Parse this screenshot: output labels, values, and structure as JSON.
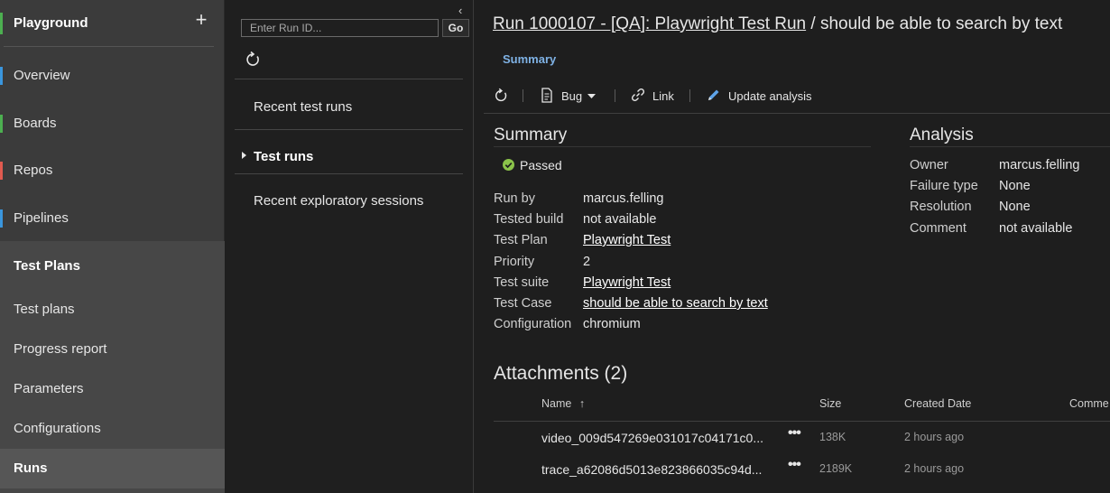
{
  "nav": {
    "project": "Playground",
    "add_label": "+",
    "items": [
      {
        "label": "Overview",
        "color": "#3a96dd"
      },
      {
        "label": "Boards",
        "color": "#4caf50"
      },
      {
        "label": "Repos",
        "color": "#e05a4f"
      },
      {
        "label": "Pipelines",
        "color": "#3a96dd"
      },
      {
        "label": "Test Plans",
        "color": "#8e44ad"
      }
    ],
    "sub_items": [
      {
        "label": "Test plans"
      },
      {
        "label": "Progress report"
      },
      {
        "label": "Parameters"
      },
      {
        "label": "Configurations"
      },
      {
        "label": "Runs"
      }
    ]
  },
  "mid": {
    "collapse_label": "‹",
    "run_id_placeholder": "Enter Run ID...",
    "go_label": "Go",
    "items": [
      {
        "label": "Recent test runs"
      },
      {
        "label": "Test runs"
      },
      {
        "label": "Recent exploratory sessions"
      }
    ]
  },
  "main": {
    "title_link": "Run 1000107 - [QA]: Playwright Test Run",
    "title_rest": " / should be able to search by text",
    "tab": "Summary",
    "toolbar": {
      "bug_label": "Bug",
      "link_label": "Link",
      "update_label": "Update analysis"
    },
    "summary": {
      "title": "Summary",
      "outcome": "Passed",
      "fields": [
        {
          "key": "Run by",
          "value": "marcus.felling",
          "link": false
        },
        {
          "key": "Tested build",
          "value": "not available",
          "link": false
        },
        {
          "key": "Test Plan",
          "value": "Playwright Test",
          "link": true
        },
        {
          "key": "Priority",
          "value": "2",
          "link": false
        },
        {
          "key": "Test suite",
          "value": "Playwright Test",
          "link": true
        },
        {
          "key": "Test Case",
          "value": "should be able to search by text",
          "link": true
        },
        {
          "key": "Configuration",
          "value": "chromium",
          "link": false
        }
      ]
    },
    "analysis": {
      "title": "Analysis",
      "fields": [
        {
          "key": "Owner",
          "value": "marcus.felling"
        },
        {
          "key": "Failure type",
          "value": "None"
        },
        {
          "key": "Resolution",
          "value": "None"
        },
        {
          "key": "Comment",
          "value": "not available"
        }
      ]
    },
    "attachments": {
      "title": "Attachments (2)",
      "columns": {
        "name": "Name",
        "sort": "↑",
        "size": "Size",
        "created": "Created Date",
        "comment": "Comme"
      },
      "rows": [
        {
          "name": "video_009d547269e031017c04171c0...",
          "size": "138K",
          "created": "2 hours ago"
        },
        {
          "name": "trace_a62086d5013e823866035c94d...",
          "size": "2189K",
          "created": "2 hours ago"
        }
      ],
      "more_label": "•••"
    }
  }
}
